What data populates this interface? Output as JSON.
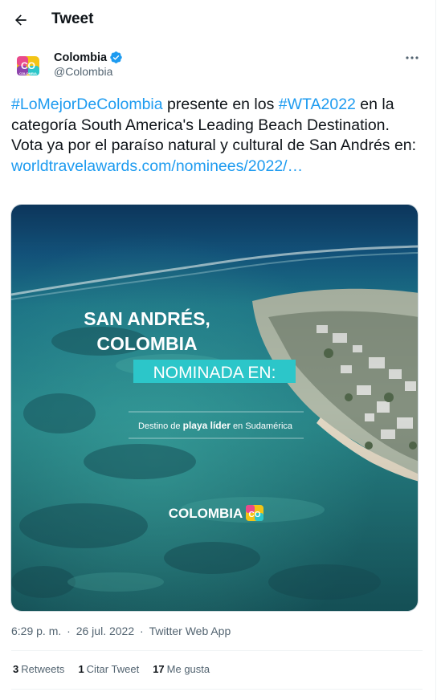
{
  "header": {
    "title": "Tweet"
  },
  "author": {
    "name": "Colombia",
    "handle": "@Colombia",
    "avatar_text": "CO",
    "avatar_subtext": "COLOMBIA"
  },
  "tweet": {
    "hashtag1": "#LoMejorDeColombia",
    "text1": " presente en los ",
    "hashtag2": "#WTA2022",
    "text2": " en la categoría South America's Leading Beach Destination. Vota ya por el paraíso natural y cultural de San Andrés en: ",
    "link": "worldtravelawards.com/nominees/2022/…"
  },
  "media": {
    "line1": "SAN ANDRÉS,",
    "line2": "COLOMBIA",
    "line3": "NOMINADA EN:",
    "caption_pre": "Destino de ",
    "caption_bold": "playa líder",
    "caption_post": " en Sudamérica",
    "brand": "COLOMBIA",
    "brand_mark": "CO"
  },
  "meta": {
    "time": "6:29 p. m.",
    "date": "26 jul. 2022",
    "source": "Twitter Web App"
  },
  "stats": [
    {
      "count": "3",
      "label": "Retweets"
    },
    {
      "count": "1",
      "label": "Citar Tweet"
    },
    {
      "count": "17",
      "label": "Me gusta"
    }
  ],
  "colors": {
    "link": "#1d9bf0",
    "verified": "#1d9bf0",
    "nominada_bg": "#2cc6c9"
  }
}
